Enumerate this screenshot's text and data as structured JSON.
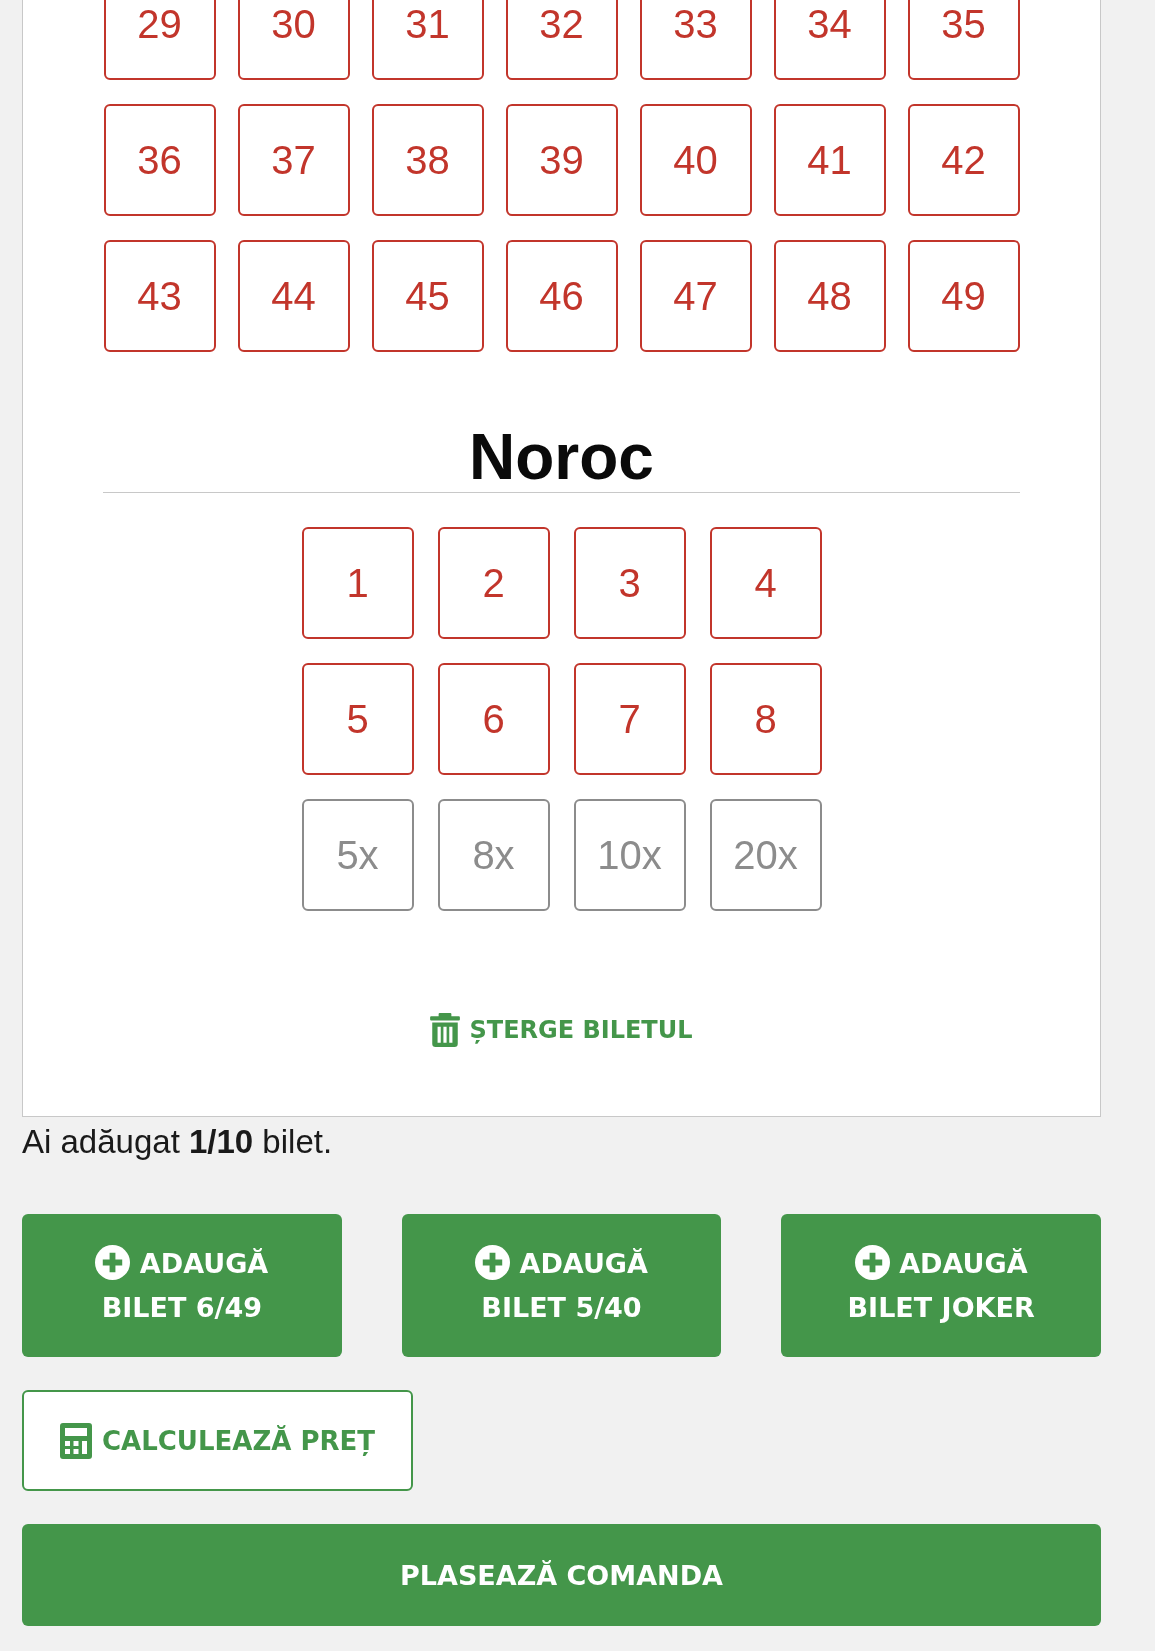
{
  "main_numbers": [
    {
      "label": "29",
      "selected": false
    },
    {
      "label": "30",
      "selected": false
    },
    {
      "label": "31",
      "selected": false
    },
    {
      "label": "32",
      "selected": false
    },
    {
      "label": "33",
      "selected": false
    },
    {
      "label": "34",
      "selected": false
    },
    {
      "label": "35",
      "selected": false
    },
    {
      "label": "36",
      "selected": false
    },
    {
      "label": "37",
      "selected": false
    },
    {
      "label": "38",
      "selected": false
    },
    {
      "label": "39",
      "selected": false
    },
    {
      "label": "40",
      "selected": false
    },
    {
      "label": "41",
      "selected": false
    },
    {
      "label": "42",
      "selected": false
    },
    {
      "label": "43",
      "selected": false
    },
    {
      "label": "44",
      "selected": false
    },
    {
      "label": "45",
      "selected": false
    },
    {
      "label": "46",
      "selected": false
    },
    {
      "label": "47",
      "selected": false
    },
    {
      "label": "48",
      "selected": false
    },
    {
      "label": "49",
      "selected": false
    }
  ],
  "noroc": {
    "title": "Noroc",
    "numbers": [
      {
        "label": "1",
        "selected": false
      },
      {
        "label": "2",
        "selected": false
      },
      {
        "label": "3",
        "selected": false
      },
      {
        "label": "4",
        "selected": false
      },
      {
        "label": "5",
        "selected": false
      },
      {
        "label": "6",
        "selected": false
      },
      {
        "label": "7",
        "selected": false
      },
      {
        "label": "8",
        "selected": false
      }
    ],
    "multipliers": [
      {
        "label": "5x",
        "selected": false,
        "disabled": true
      },
      {
        "label": "8x",
        "selected": false,
        "disabled": true
      },
      {
        "label": "10x",
        "selected": false,
        "disabled": true
      },
      {
        "label": "20x",
        "selected": false,
        "disabled": true
      }
    ]
  },
  "delete_ticket": {
    "label": "ȘTERGE BILETUL"
  },
  "ticket_count": "Ai adăugat **1/10** bilet.",
  "add_buttons": [
    {
      "label": "ADAUGĂ BILET 6/49"
    },
    {
      "label": "ADAUGĂ BILET 5/40"
    },
    {
      "label": "ADAUGĂ BILET JOKER"
    }
  ],
  "calculate_button": {
    "label": "CALCULEAZĂ PREȚ"
  },
  "order_button": {
    "label": "PLASEAZĂ COMANDA"
  }
}
